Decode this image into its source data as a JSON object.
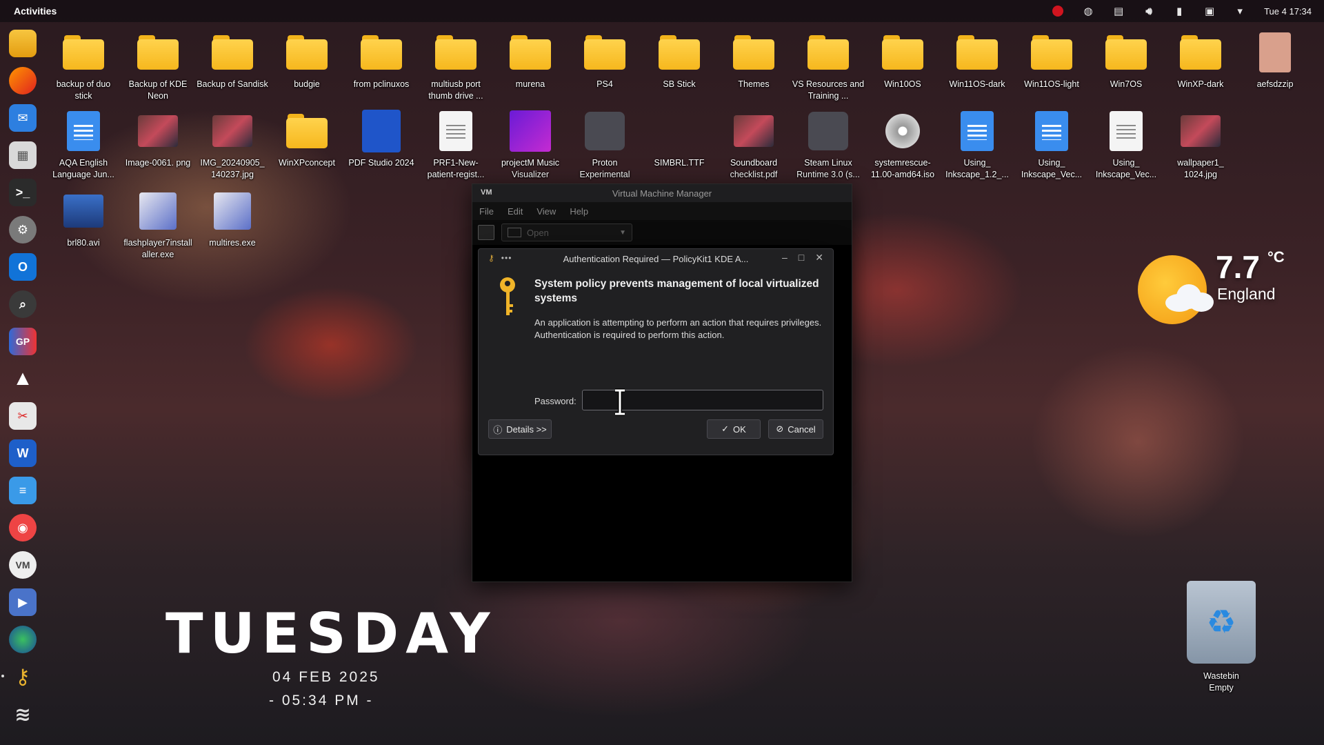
{
  "topbar": {
    "activities": "Activities",
    "clock": "Tue 4 17:34",
    "tray_icons": [
      "record-indicator",
      "vpn-icon",
      "clipboard-icon",
      "volume-icon",
      "usb-icon",
      "display-icon",
      "dropdown-icon"
    ]
  },
  "dock": {
    "apps": [
      "files",
      "firefox",
      "mail",
      "app-grid",
      "terminal",
      "settings",
      "outlook",
      "search",
      "gparted",
      "inkscape",
      "screenshot",
      "word",
      "document-viewer",
      "disks",
      "vmm",
      "media-player",
      "browser",
      "keyring",
      "zorin"
    ]
  },
  "desktop": {
    "row1": [
      {
        "label": "backup of duo stick",
        "type": "folder-doc"
      },
      {
        "label": "Backup of KDE Neon",
        "type": "folder-doc"
      },
      {
        "label": "Backup of Sandisk",
        "type": "folder-img"
      },
      {
        "label": "budgie",
        "type": "folder-img"
      },
      {
        "label": "from pclinuxos",
        "type": "folder"
      },
      {
        "label": "multiusb port thumb drive ...",
        "type": "folder-img"
      },
      {
        "label": "murena",
        "type": "folder"
      },
      {
        "label": "PS4",
        "type": "folder"
      },
      {
        "label": "SB Stick",
        "type": "folder-img"
      },
      {
        "label": "Themes",
        "type": "folder"
      },
      {
        "label": "VS Resources and Training ...",
        "type": "folder-img"
      },
      {
        "label": "Win10OS",
        "type": "folder"
      },
      {
        "label": "Win11OS-dark",
        "type": "folder"
      },
      {
        "label": "Win11OS-light",
        "type": "folder"
      },
      {
        "label": "Win7OS",
        "type": "folder"
      },
      {
        "label": "WinXP-dark",
        "type": "folder"
      },
      {
        "label": "aefsdzzip",
        "type": "archive"
      }
    ],
    "row2": [
      {
        "label": "AQA English Language Jun...",
        "type": "doc"
      },
      {
        "label": "Image-0061. png",
        "type": "image"
      },
      {
        "label": "IMG_20240905_ 140237.jpg",
        "type": "image"
      },
      {
        "label": "WinXPconcept",
        "type": "folder"
      },
      {
        "label": "PDF Studio 2024",
        "type": "pdf-app"
      },
      {
        "label": "PRF1-New- patient-regist...",
        "type": "doc-white"
      },
      {
        "label": "projectM Music Visualizer",
        "type": "app"
      },
      {
        "label": "Proton Experimental",
        "type": "steam"
      },
      {
        "label": "SIMBRL.TTF",
        "type": "font"
      },
      {
        "label": "Soundboard checklist.pdf",
        "type": "image"
      },
      {
        "label": "Steam Linux Runtime 3.0 (s...",
        "type": "steam"
      },
      {
        "label": "systemrescue- 11.00-amd64.iso",
        "type": "disc"
      },
      {
        "label": "Using_ Inkscape_1.2_...",
        "type": "doc"
      },
      {
        "label": "Using_ Inkscape_Vec...",
        "type": "doc"
      },
      {
        "label": "Using_ Inkscape_Vec...",
        "type": "doc-white"
      },
      {
        "label": "wallpaper1_ 1024.jpg",
        "type": "image"
      }
    ],
    "row3": [
      {
        "label": "brl80.avi",
        "type": "video"
      },
      {
        "label": "flashplayer7install aller.exe",
        "type": "exe"
      },
      {
        "label": "multires.exe",
        "type": "exe"
      }
    ]
  },
  "vmm": {
    "title": "Virtual Machine Manager",
    "menu": [
      "File",
      "Edit",
      "View",
      "Help"
    ],
    "open_label": "Open"
  },
  "auth": {
    "title": "Authentication Required — PolicyKit1 KDE A...",
    "heading": "System policy prevents management of local virtualized systems",
    "body": "An application is attempting to perform an action that requires privileges. Authentication is required to perform this action.",
    "password_label": "Password:",
    "password_value": "",
    "details_label": "Details >>",
    "ok_label": "OK",
    "cancel_label": "Cancel"
  },
  "weather": {
    "temp": "7.7",
    "unit": "°C",
    "location": "England"
  },
  "datetime": {
    "day": "TUESDAY",
    "date": "04 FEB 2025",
    "time": "- 05:34 PM -"
  },
  "wastebin": {
    "label": "Wastebin",
    "status": "Empty"
  },
  "colors": {
    "folder": "#f6b71d",
    "doc_blue": "#3a8dee",
    "record_red": "#d0141f",
    "dialog_bg": "#202022"
  }
}
